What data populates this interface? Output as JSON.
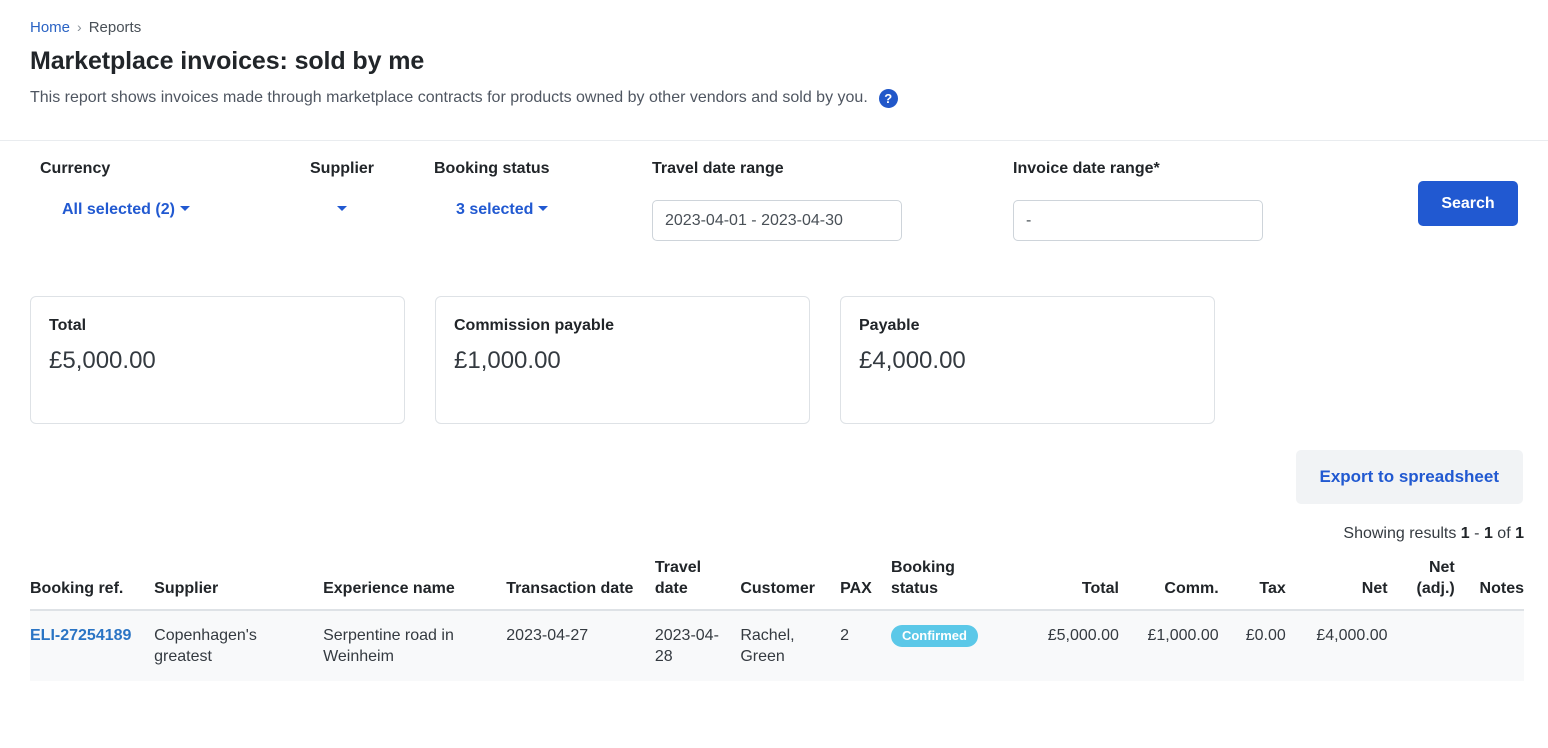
{
  "breadcrumb": {
    "home": "Home",
    "separator": "›",
    "current": "Reports"
  },
  "header": {
    "title": "Marketplace invoices: sold by me",
    "description": "This report shows invoices made through marketplace contracts for products owned by other vendors and sold by you.",
    "help_icon": "?"
  },
  "filters": {
    "currency": {
      "label": "Currency",
      "value": "All selected (2)"
    },
    "supplier": {
      "label": "Supplier",
      "value": ""
    },
    "booking_status": {
      "label": "Booking status",
      "value": "3 selected"
    },
    "travel_date_range": {
      "label": "Travel date range",
      "value": "2023-04-01 - 2023-04-30",
      "placeholder": "2023-04-01 - 2023-04-30"
    },
    "invoice_date_range": {
      "label": "Invoice date range*",
      "value": "-",
      "placeholder": "-"
    },
    "search_button": "Search"
  },
  "summary_cards": [
    {
      "title": "Total",
      "value": "£5,000.00"
    },
    {
      "title": "Commission payable",
      "value": "£1,000.00"
    },
    {
      "title": "Payable",
      "value": "£4,000.00"
    }
  ],
  "actions": {
    "export_label": "Export to spreadsheet"
  },
  "results_info": {
    "prefix": "Showing results",
    "from": "1",
    "dash": "-",
    "to": "1",
    "of_label": "of",
    "total": "1"
  },
  "table": {
    "columns": [
      "Booking ref.",
      "Supplier",
      "Experience name",
      "Transaction date",
      "Travel date",
      "Customer",
      "PAX",
      "Booking status",
      "Total",
      "Comm.",
      "Tax",
      "Net",
      "Net (adj.)",
      "Notes"
    ],
    "rows": [
      {
        "booking_ref": "ELI-27254189",
        "supplier": "Copenhagen's greatest",
        "experience_name": "Serpentine road in Weinheim",
        "transaction_date": "2023-04-27",
        "travel_date": "2023-04-28",
        "customer": "Rachel, Green",
        "pax": "2",
        "booking_status": "Confirmed",
        "total": "£5,000.00",
        "comm": "£1,000.00",
        "tax": "£0.00",
        "net": "£4,000.00",
        "net_adj": "",
        "notes": ""
      }
    ]
  },
  "colors": {
    "accent_blue": "#2159d1",
    "link_blue": "#2a63c4",
    "badge_cyan": "#5bc8e8",
    "card_border": "#dee2e6",
    "row_bg": "#f8f9fa"
  }
}
